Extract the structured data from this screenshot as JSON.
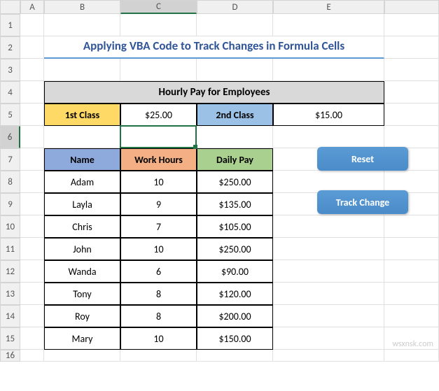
{
  "columns": [
    "A",
    "B",
    "C",
    "D",
    "E"
  ],
  "rows": [
    1,
    2,
    3,
    4,
    5,
    6,
    7,
    8,
    9,
    10,
    11,
    12,
    13,
    14,
    15,
    16
  ],
  "selected_cell": "C6",
  "title": "Applying VBA Code to Track Changes in Formula Cells",
  "section_header": "Hourly Pay for Employees",
  "class_row": {
    "label1": "1st Class",
    "value1": "$25.00",
    "label2": "2nd Class",
    "value2": "$15.00"
  },
  "table": {
    "headers": {
      "name": "Name",
      "hours": "Work Hours",
      "pay": "Daily Pay"
    },
    "rows": [
      {
        "name": "Adam",
        "hours": "10",
        "pay": "$250.00"
      },
      {
        "name": "Layla",
        "hours": "9",
        "pay": "$135.00"
      },
      {
        "name": "Chris",
        "hours": "7",
        "pay": "$105.00"
      },
      {
        "name": "John",
        "hours": "10",
        "pay": "$250.00"
      },
      {
        "name": "Wanda",
        "hours": "6",
        "pay": "$90.00"
      },
      {
        "name": "Tony",
        "hours": "8",
        "pay": "$120.00"
      },
      {
        "name": "Roy",
        "hours": "8",
        "pay": "$200.00"
      },
      {
        "name": "Mary",
        "hours": "10",
        "pay": "$150.00"
      }
    ]
  },
  "buttons": {
    "reset": "Reset",
    "track": "Track Change"
  },
  "watermark": "wsxnsk.com",
  "chart_data": {
    "type": "table",
    "title": "Hourly Pay for Employees",
    "parameters": {
      "1st Class": 25.0,
      "2nd Class": 15.0
    },
    "columns": [
      "Name",
      "Work Hours",
      "Daily Pay"
    ],
    "rows": [
      [
        "Adam",
        10,
        250.0
      ],
      [
        "Layla",
        9,
        135.0
      ],
      [
        "Chris",
        7,
        105.0
      ],
      [
        "John",
        10,
        250.0
      ],
      [
        "Wanda",
        6,
        90.0
      ],
      [
        "Tony",
        8,
        120.0
      ],
      [
        "Roy",
        8,
        200.0
      ],
      [
        "Mary",
        10,
        150.0
      ]
    ]
  }
}
